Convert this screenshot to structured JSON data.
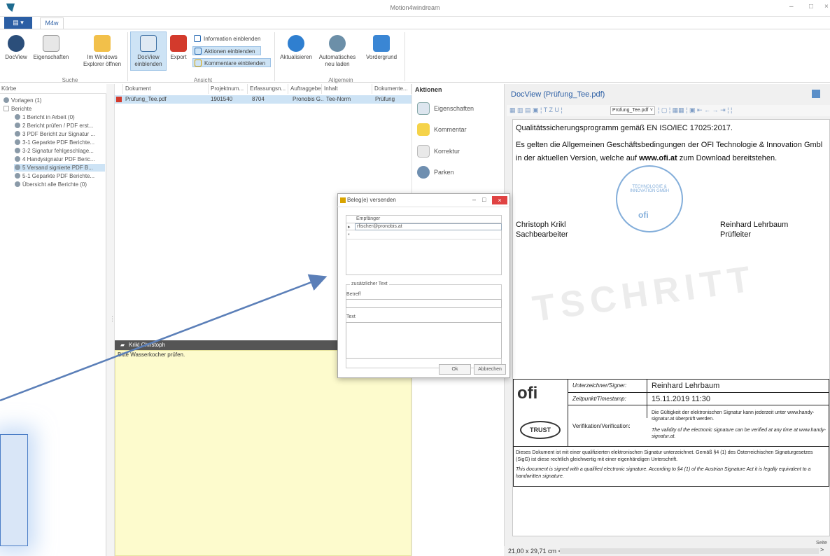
{
  "window": {
    "title": "Motion4windream",
    "minimize": "–",
    "maximize": "□",
    "close": "×"
  },
  "ribbon": {
    "tab": "M4w",
    "buttons": {
      "docview": "DocView",
      "eigenschaften": "Eigenschaften",
      "explorer": "Im Windows Explorer öffnen",
      "docview_einblenden": "DocView einblenden",
      "export": "Export",
      "aktualisieren": "Aktualisieren",
      "auto_neu_laden": "Automatisches neu laden",
      "vordergrund": "Vordergrund"
    },
    "small_buttons": {
      "information": "Information einblenden",
      "aktionen": "Aktionen einblenden",
      "kommentare": "Kommentare einblenden"
    },
    "groups": {
      "suche": "Suche",
      "ansicht": "Ansicht",
      "allgemein": "Allgemein"
    }
  },
  "left_pane": {
    "header": "Körbe",
    "items": [
      "Vorlagen (1)",
      "Berichte",
      "1 Bericht in Arbeit (0)",
      "2 Bericht prüfen / PDF erst...",
      "3 PDF Bericht zur Signatur ...",
      "3-1 Geparkte PDF Berichte...",
      "3-2 Signatur fehlgeschlage...",
      "4 Handysignatur PDF Beric...",
      "5 Versand signierte PDF B...",
      "5-1 Geparkte PDF Berichte...",
      "Übersicht alle Berichte (0)"
    ]
  },
  "grid": {
    "columns": [
      "Dokument",
      "Projektnum...",
      "Erfassungsn...",
      "Auftraggeber",
      "Inhalt",
      "Dokumente..."
    ],
    "rows": [
      [
        "Prüfung_Tee.pdf",
        "1901540",
        "8704",
        "Pronobis G...",
        "Tee-Norm",
        "Prüfung"
      ]
    ]
  },
  "comment": {
    "author": "Krikl Christoph",
    "text": "Bitte Wasserkocher prüfen."
  },
  "actions": {
    "header": "Aktionen",
    "items": [
      "Eigenschaften",
      "Kommentar",
      "Korrektur",
      "Parken"
    ]
  },
  "docview": {
    "title": "DocView (Prüfung_Tee.pdf)",
    "toolbar_file": "Prüfung_Tee.pdf",
    "page_size": "21,00 x 29,71 cm",
    "page_label": "Seite",
    "doc": {
      "line1": "Qualitätssicherungsprogramm gemäß EN ISO/IEC 17025:2017.",
      "line2": "Es gelten die Allgemeinen Geschäftsbedingungen der OFI Technologie & Innovation Gmbl",
      "line3_pre": "in der aktuellen Version, welche auf ",
      "line3_link": "www.ofi.at",
      "line3_post": " zum Download bereitstehen.",
      "person1_name": "Christoph Krikl",
      "person1_role": "Sachbearbeiter",
      "person2_name": "Reinhard Lehrbaum",
      "person2_role": "Prüfleiter",
      "stamp_text": "TECHNOLOGIE & INNOVATION GMBH",
      "stamp_logo": "ofi",
      "watermark": "TSCHRITT"
    },
    "signature": {
      "logo": "ofi",
      "trust": "TRUST",
      "signer_label": "Unterzeichner/Signer:",
      "signer_value": "Reinhard Lehrbaum",
      "time_label": "Zeitpunkt/Timestamp:",
      "time_value": "15.11.2019 11:30",
      "verify_label": "Verifikation/Verification:",
      "verify_de": "Die Gültigkeit der elektronischen Signatur kann jederzeit unter www.handy-signatur.at überprüft werden.",
      "verify_en": "The validity of the electronic signature can be verified at any time at www.handy-signatur.at.",
      "footer_de": "Dieses Dokument ist mit einer qualifizierten elektronischen Signatur unterzeichnet. Gemäß §4 (1) des Österreichischen Signaturgesetzes (SigG) ist diese rechtlich gleichwertig mit einer eigenhändigen Unterschrift.",
      "footer_en": "This document is signed with a qualified electronic signature. According to §4 (1) of the Austrian Signature Act it is legally equivalent to a handwritten signature."
    }
  },
  "dialog": {
    "title": "Beleg(e) versenden",
    "recipients_header": "Empfänger",
    "recipient": "rfischer@pronobis.at",
    "new_row_marker": "*",
    "extra_text_group": "zusätzlicher Text",
    "subject_label": "Betreff",
    "subject_value": "",
    "text_label": "Text",
    "text_value": "",
    "ok": "Ok",
    "cancel": "Abbrechen"
  },
  "colors": {
    "accent": "#2b5ea4",
    "selection": "#cde3f5",
    "comment_bg": "#fdfbcd",
    "arrow": "#5b7fb8"
  }
}
